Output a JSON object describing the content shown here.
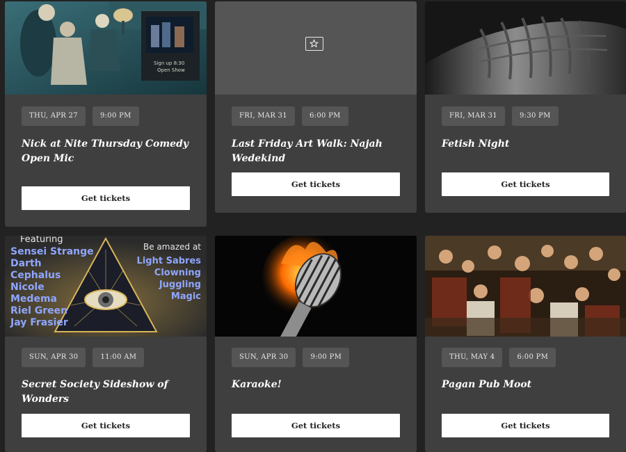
{
  "events": [
    {
      "date": "THU, APR 27",
      "time": "9:00 PM",
      "title": "Nick at Nite Thursday Comedy Open Mic",
      "button": "Get tickets",
      "tv_screen_text": [
        "Sign up 8:30",
        "Open Show"
      ]
    },
    {
      "date": "FRI, MAR 31",
      "time": "6:00 PM",
      "title": "Last Friday Art Walk: Najah Wedekind",
      "button": "Get tickets",
      "placeholder_icon": "star-image-icon"
    },
    {
      "date": "FRI, MAR 31",
      "time": "9:30 PM",
      "title": "Fetish Night",
      "button": "Get tickets"
    },
    {
      "date": "SUN, APR 30",
      "time": "11:00 AM",
      "title": "Secret Society Sideshow of Wonders",
      "button": "Get tickets",
      "flyer": {
        "featuring_label": "Featuring",
        "performers": [
          "Sensei Strange",
          "Darth Cephalus",
          "Nicole Medema",
          "Riel Green",
          "Jay Frasier"
        ],
        "amazed_label": "Be amazed at",
        "acts": [
          "Light Sabres",
          "Clowning",
          "Juggling",
          "Magic"
        ]
      }
    },
    {
      "date": "SUN, APR 30",
      "time": "9:00 PM",
      "title": "Karaoke!",
      "button": "Get tickets"
    },
    {
      "date": "THU, MAY 4",
      "time": "6:00 PM",
      "title": "Pagan Pub Moot",
      "button": "Get tickets"
    }
  ]
}
